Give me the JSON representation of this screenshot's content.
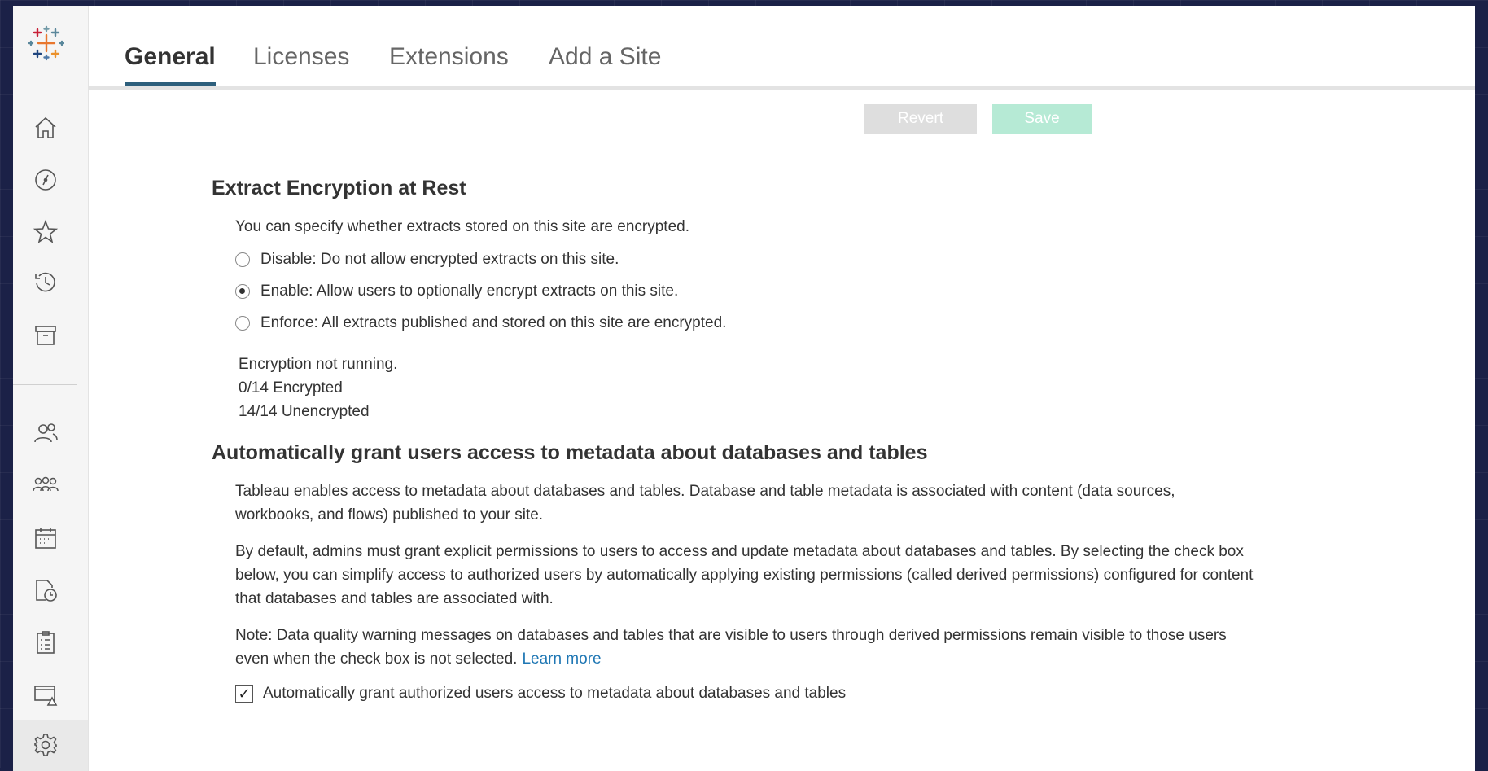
{
  "tabs": [
    {
      "label": "General",
      "active": true
    },
    {
      "label": "Licenses",
      "active": false
    },
    {
      "label": "Extensions",
      "active": false
    },
    {
      "label": "Add a Site",
      "active": false
    }
  ],
  "toolbar": {
    "revert_label": "Revert",
    "save_label": "Save"
  },
  "sidebar": {
    "items": [
      {
        "icon": "home-icon"
      },
      {
        "icon": "compass-icon"
      },
      {
        "icon": "star-icon"
      },
      {
        "icon": "history-icon"
      },
      {
        "icon": "archive-icon"
      },
      {
        "icon": "users-icon"
      },
      {
        "icon": "groups-icon"
      },
      {
        "icon": "calendar-icon"
      },
      {
        "icon": "jobs-icon"
      },
      {
        "icon": "tasks-icon"
      },
      {
        "icon": "status-icon"
      },
      {
        "icon": "gear-icon",
        "active": true
      }
    ]
  },
  "encryption": {
    "heading": "Extract Encryption at Rest",
    "description": "You can specify whether extracts stored on this site are encrypted.",
    "options": [
      {
        "label": "Disable: Do not allow encrypted extracts on this site.",
        "checked": false
      },
      {
        "label": "Enable: Allow users to optionally encrypt extracts on this site.",
        "checked": true
      },
      {
        "label": "Enforce: All extracts published and stored on this site are encrypted.",
        "checked": false
      }
    ],
    "status_line1": "Encryption not running.",
    "status_line2": "0/14 Encrypted",
    "status_line3": "14/14 Unencrypted"
  },
  "metadata": {
    "heading": "Automatically grant users access to metadata about databases and tables",
    "para1": "Tableau enables access to metadata about databases and tables. Database and table metadata is associated with content (data sources, workbooks, and flows) published to your site.",
    "para2": "By default, admins must grant explicit permissions to users to access and update metadata about databases and tables. By selecting the check box below, you can simplify access to authorized users by automatically applying existing permissions (called derived permissions) configured for content that databases and tables are associated with.",
    "para3": "Note: Data quality warning messages on databases and tables that are visible to users through derived permissions remain visible to those users even when the check box is not selected.",
    "learn_more": "Learn more",
    "checkbox_label": "Automatically grant authorized users access to metadata about databases and tables",
    "checkbox_checked": true,
    "checkbox_mark": "✓"
  },
  "colors": {
    "accent": "#2d5f7c",
    "link": "#1f77b4",
    "save_disabled": "#b6ead5",
    "revert_disabled": "#dedede"
  }
}
